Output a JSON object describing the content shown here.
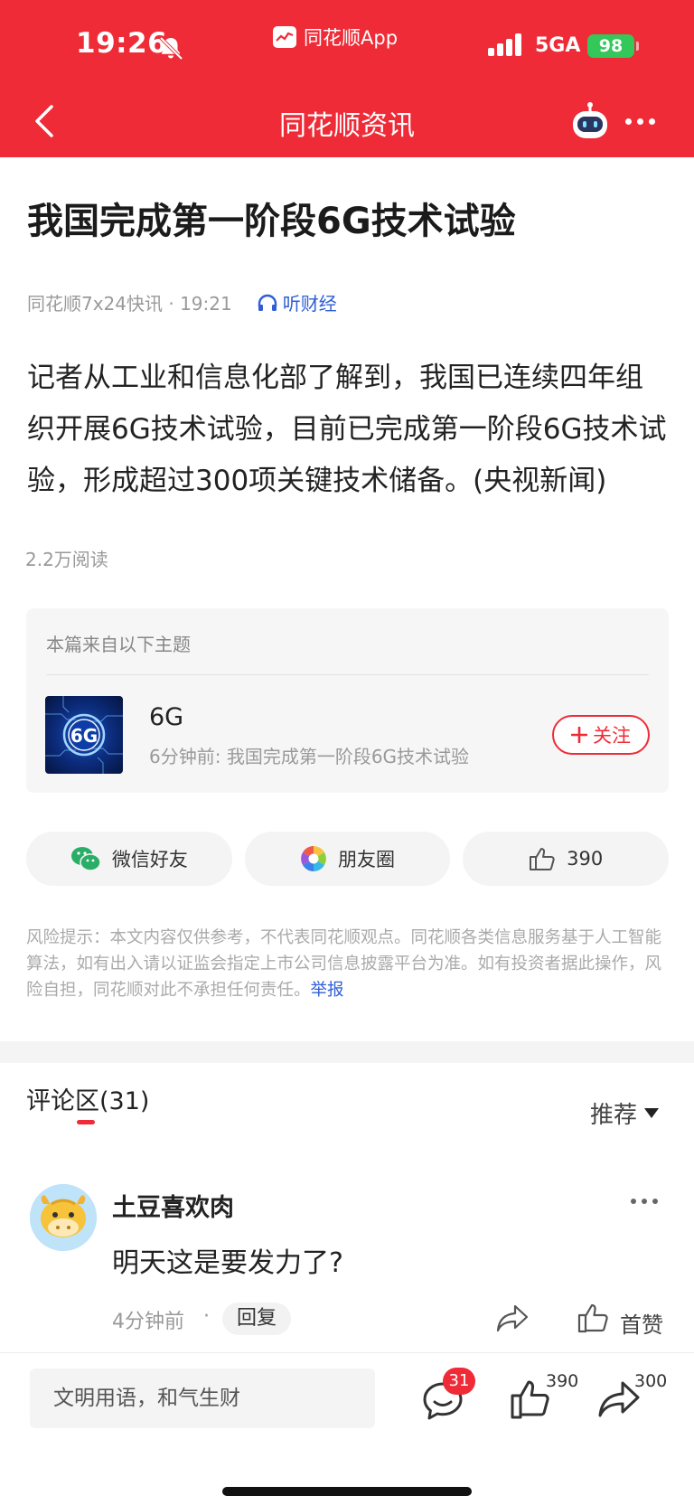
{
  "status_bar": {
    "time": "19:26",
    "app_name": "同花顺App",
    "network": "5GA",
    "battery": "98"
  },
  "nav": {
    "title": "同花顺资讯"
  },
  "article": {
    "title": "我国完成第一阶段6G技术试验",
    "source_time": "同花顺7x24快讯 · 19:21",
    "listen_label": "听财经",
    "body": "记者从工业和信息化部了解到，我国已连续四年组织开展6G技术试验，目前已完成第一阶段6G技术试验，形成超过300项关键技术储备。(央视新闻)",
    "reads": "2.2万阅读"
  },
  "topic": {
    "caption": "本篇来自以下主题",
    "thumb_text": "6G",
    "name": "6G",
    "latest": "6分钟前: 我国完成第一阶段6G技术试验",
    "follow_label": "关注"
  },
  "share": {
    "wechat_label": "微信好友",
    "moments_label": "朋友圈",
    "like_count": "390"
  },
  "risk": {
    "text": "风险提示：本文内容仅供参考，不代表同花顺观点。同花顺各类信息服务基于人工智能算法，如有出入请以证监会指定上市公司信息披露平台为准。如有投资者据此操作，风险自担，同花顺对此不承担任何责任。",
    "report_label": "举报"
  },
  "comments": {
    "title": "评论区(31)",
    "sort_label": "推荐",
    "items": [
      {
        "user": "土豆喜欢肉",
        "text": "明天这是要发力了?",
        "time": "4分钟前",
        "reply_label": "回复",
        "like_label": "首赞"
      }
    ]
  },
  "bottom_bar": {
    "input_placeholder": "文明用语，和气生财",
    "comment_badge": "31",
    "like_count": "390",
    "share_count": "300"
  },
  "colors": {
    "brand_red": "#ef2b37",
    "link_blue": "#2f5ed6"
  }
}
